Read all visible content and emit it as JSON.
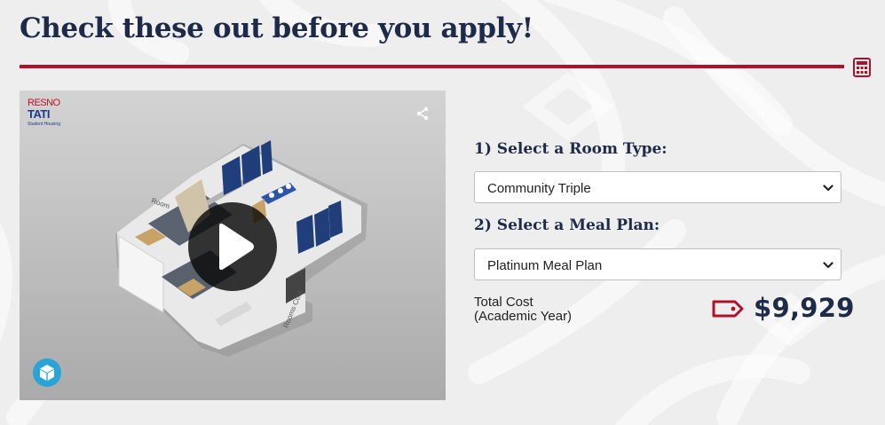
{
  "page": {
    "title": "Check these out before you apply!"
  },
  "colors": {
    "accent": "#b1102b",
    "navy": "#1d2a48",
    "play_overlay": "#0a0a0a",
    "viewer_badge": "#2aa3d6"
  },
  "viewer": {
    "logo_line1": "RESNO",
    "logo_line2": "TATI",
    "logo_line3": "Student Housing",
    "wall_label_1": "Room",
    "wall_label_2": "Rooms Cont",
    "share_icon": "share-icon",
    "play_icon": "play-icon",
    "badge_icon": "cube-icon"
  },
  "calculator": {
    "calc_icon": "calculator-icon",
    "step1_label": "1) Select a Room Type:",
    "room_type_value": "Community Triple",
    "step2_label": "2) Select a Meal Plan:",
    "meal_plan_value": "Platinum Meal Plan",
    "total_label_line1": "Total Cost",
    "total_label_line2": "(Academic Year)",
    "price_icon": "price-tag-icon",
    "total_price": "$9,929"
  }
}
